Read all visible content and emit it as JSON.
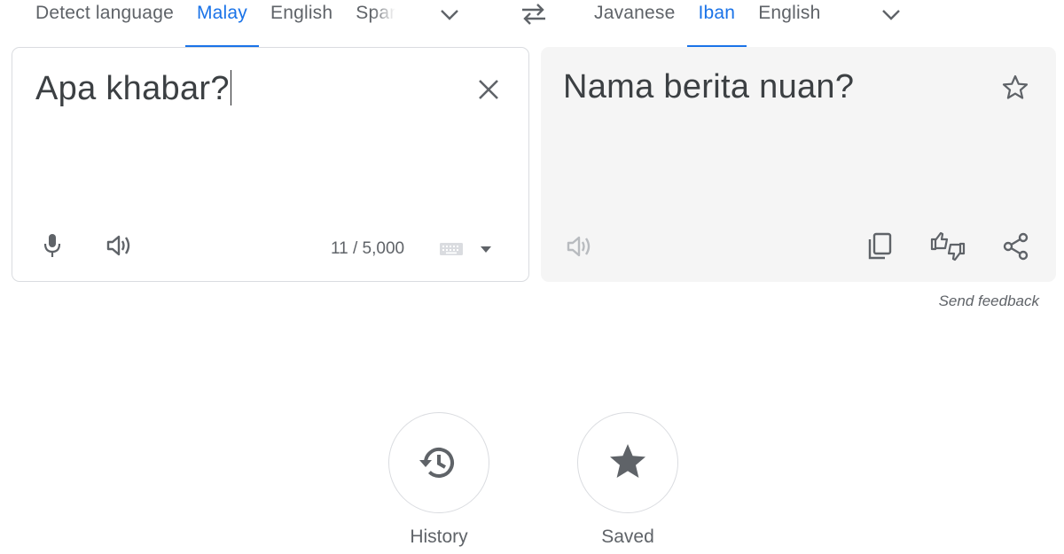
{
  "source_languages": {
    "tabs": [
      {
        "label": "Detect language",
        "active": false
      },
      {
        "label": "Malay",
        "active": true
      },
      {
        "label": "English",
        "active": false
      },
      {
        "label": "Spanish",
        "active": false
      }
    ],
    "more_icon": "chevron-down-icon"
  },
  "swap_icon": "swap-arrows-icon",
  "target_languages": {
    "tabs": [
      {
        "label": "Javanese",
        "active": false
      },
      {
        "label": "Iban",
        "active": true
      },
      {
        "label": "English",
        "active": false
      }
    ],
    "more_icon": "chevron-down-icon"
  },
  "source_panel": {
    "text": "Apa khabar?",
    "char_count": "11 / 5,000",
    "icons": [
      "close-icon",
      "microphone-icon",
      "speaker-icon",
      "keyboard-icon",
      "dropdown-arrow-icon"
    ]
  },
  "target_panel": {
    "text": "Nama berita nuan?",
    "icons": [
      "star-outline-icon",
      "speaker-icon",
      "copy-icon",
      "rate-translation-icon",
      "share-icon"
    ]
  },
  "feedback_link": "Send feedback",
  "bottom_actions": [
    {
      "label": "History",
      "icon": "history-icon"
    },
    {
      "label": "Saved",
      "icon": "star-icon"
    }
  ],
  "colors": {
    "accent": "#1a73e8",
    "icon": "#5f6368",
    "text": "#3c4043",
    "border": "#dadce0",
    "target_panel_bg": "#f5f5f5"
  }
}
